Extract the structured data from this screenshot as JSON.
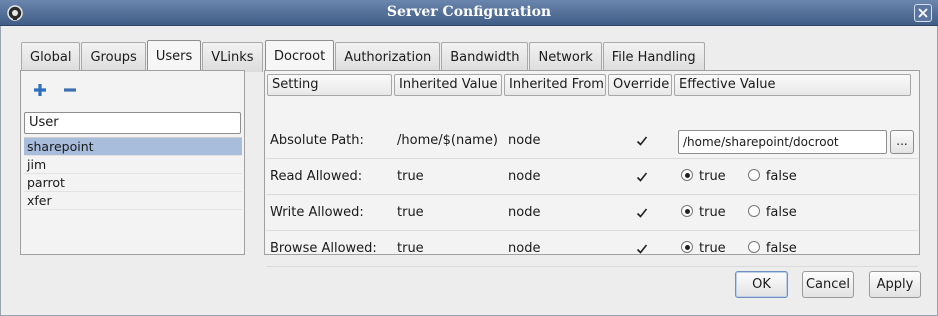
{
  "window": {
    "title": "Server Configuration",
    "app_icon": "app-icon",
    "close_icon": "close-icon"
  },
  "left_tabs": [
    "Global",
    "Groups",
    "Users",
    "VLinks"
  ],
  "left_active_tab": "Users",
  "users_panel": {
    "add_icon": "plus-icon",
    "remove_icon": "minus-icon",
    "header_label": "User",
    "users": [
      "sharepoint",
      "jim",
      "parrot",
      "xfer"
    ],
    "selected_user": "sharepoint"
  },
  "right_tabs": [
    "Docroot",
    "Authorization",
    "Bandwidth",
    "Network",
    "File Handling"
  ],
  "right_active_tab": "Docroot",
  "table": {
    "columns": [
      "Setting",
      "Inherited Value",
      "Inherited From",
      "Override",
      "Effective Value"
    ],
    "rows": [
      {
        "setting": "Absolute Path:",
        "inherited_value": "/home/$(name)",
        "inherited_from": "node",
        "override": true,
        "effective_value": "/home/sharepoint/docroot",
        "browse_label": "..."
      },
      {
        "setting": "Read Allowed:",
        "inherited_value": "true",
        "inherited_from": "node",
        "override": true,
        "true_label": "true",
        "false_label": "false",
        "selected": "true"
      },
      {
        "setting": "Write Allowed:",
        "inherited_value": "true",
        "inherited_from": "node",
        "override": true,
        "true_label": "true",
        "false_label": "false",
        "selected": "true"
      },
      {
        "setting": "Browse Allowed:",
        "inherited_value": "true",
        "inherited_from": "node",
        "override": true,
        "true_label": "true",
        "false_label": "false",
        "selected": "true"
      }
    ]
  },
  "buttons": {
    "ok": "OK",
    "cancel": "Cancel",
    "apply": "Apply"
  },
  "colors": {
    "titlebar": "#4f6c95",
    "selection": "#a8bcdc",
    "add_icon": "#2f6fbf",
    "remove_icon": "#3f6fb0"
  }
}
